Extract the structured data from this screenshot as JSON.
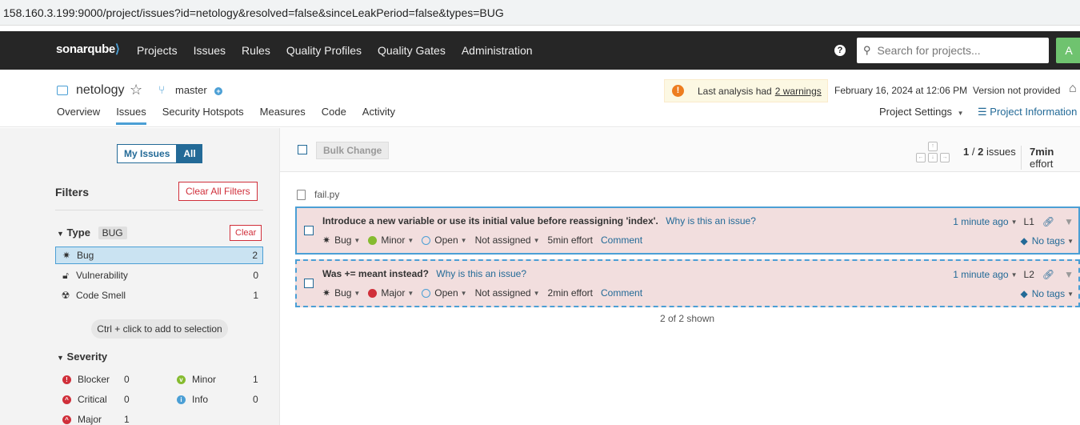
{
  "browser": {
    "url": "158.160.3.199:9000/project/issues?id=netology&resolved=false&sinceLeakPeriod=false&types=BUG"
  },
  "topnav": {
    "logo": "sonarqube",
    "items": [
      "Projects",
      "Issues",
      "Rules",
      "Quality Profiles",
      "Quality Gates",
      "Administration"
    ],
    "search_placeholder": "Search for projects...",
    "avatar_letter": "A"
  },
  "project": {
    "name": "netology",
    "branch": "master",
    "warning_prefix": "Last analysis had",
    "warning_link": "2 warnings",
    "analysis_date": "February 16, 2024 at 12:06 PM",
    "version": "Version not provided",
    "tabs": [
      "Overview",
      "Issues",
      "Security Hotspots",
      "Measures",
      "Code",
      "Activity"
    ],
    "settings": "Project Settings",
    "info": "Project Information"
  },
  "sidebar": {
    "my_issues": "My Issues",
    "all": "All",
    "filters_title": "Filters",
    "clear_all": "Clear All Filters",
    "type_label": "Type",
    "type_chip": "BUG",
    "clear": "Clear",
    "types": [
      {
        "label": "Bug",
        "count": "2"
      },
      {
        "label": "Vulnerability",
        "count": "0"
      },
      {
        "label": "Code Smell",
        "count": "1"
      }
    ],
    "ctrl_hint": "Ctrl + click to add to selection",
    "severity_label": "Severity",
    "severities": [
      {
        "label": "Blocker",
        "count": "0"
      },
      {
        "label": "Minor",
        "count": "1"
      },
      {
        "label": "Critical",
        "count": "0"
      },
      {
        "label": "Info",
        "count": "0"
      },
      {
        "label": "Major",
        "count": "1"
      }
    ]
  },
  "toolbar": {
    "bulk_change": "Bulk Change",
    "count_current": "1",
    "count_total": "2",
    "count_label": "issues",
    "effort_value": "7min",
    "effort_label": "effort"
  },
  "file": "fail.py",
  "issues": [
    {
      "message": "Introduce a new variable or use its initial value before reassigning 'index'.",
      "why": "Why is this an issue?",
      "type": "Bug",
      "severity": "Minor",
      "status": "Open",
      "assignee": "Not assigned",
      "effort": "5min effort",
      "comment": "Comment",
      "age": "1 minute ago",
      "line": "L1",
      "tags": "No tags"
    },
    {
      "message": "Was += meant instead?",
      "why": "Why is this an issue?",
      "type": "Bug",
      "severity": "Major",
      "status": "Open",
      "assignee": "Not assigned",
      "effort": "2min effort",
      "comment": "Comment",
      "age": "1 minute ago",
      "line": "L2",
      "tags": "No tags"
    }
  ],
  "shown": "2 of 2 shown"
}
